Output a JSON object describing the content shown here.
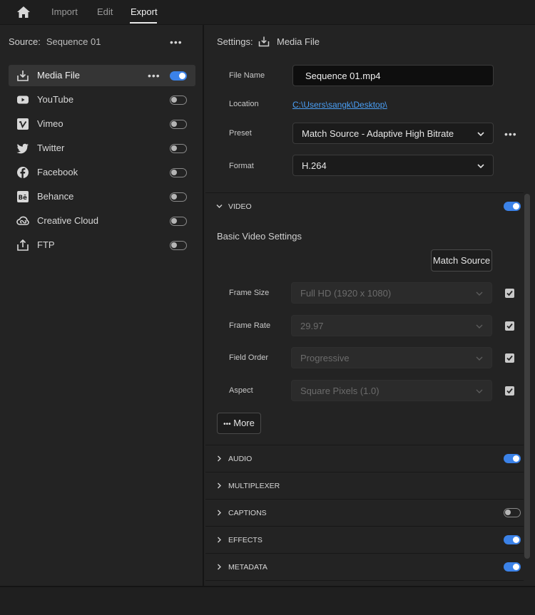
{
  "nav": {
    "tabs": [
      {
        "label": "Import"
      },
      {
        "label": "Edit"
      },
      {
        "label": "Export"
      }
    ]
  },
  "source": {
    "label": "Source:",
    "value": "Sequence 01"
  },
  "destinations": [
    {
      "label": "Media File",
      "icon": "download-icon",
      "enabled": true
    },
    {
      "label": "YouTube",
      "icon": "youtube-icon",
      "enabled": false
    },
    {
      "label": "Vimeo",
      "icon": "vimeo-icon",
      "enabled": false
    },
    {
      "label": "Twitter",
      "icon": "twitter-icon",
      "enabled": false
    },
    {
      "label": "Facebook",
      "icon": "facebook-icon",
      "enabled": false
    },
    {
      "label": "Behance",
      "icon": "behance-icon",
      "enabled": false
    },
    {
      "label": "Creative Cloud",
      "icon": "creative-cloud-icon",
      "enabled": false
    },
    {
      "label": "FTP",
      "icon": "upload-icon",
      "enabled": false
    }
  ],
  "settings": {
    "label": "Settings:",
    "value": "Media File",
    "file_name_label": "File Name",
    "file_name": "Sequence 01.mp4",
    "location_label": "Location",
    "location": "C:\\Users\\sangk\\Desktop\\",
    "preset_label": "Preset",
    "preset": "Match Source - Adaptive High Bitrate",
    "format_label": "Format",
    "format": "H.264"
  },
  "video": {
    "title": "VIDEO",
    "enabled": true,
    "basic_title": "Basic Video Settings",
    "match_source_label": "Match Source",
    "fields": [
      {
        "label": "Frame Size",
        "value": "Full HD (1920 x 1080)",
        "checked": true
      },
      {
        "label": "Frame Rate",
        "value": "29.97",
        "checked": true
      },
      {
        "label": "Field Order",
        "value": "Progressive",
        "checked": true
      },
      {
        "label": "Aspect",
        "value": "Square Pixels (1.0)",
        "checked": true
      }
    ],
    "more_label": "More"
  },
  "sections": [
    {
      "title": "AUDIO",
      "toggle": true,
      "enabled": true
    },
    {
      "title": "MULTIPLEXER",
      "toggle": false
    },
    {
      "title": "CAPTIONS",
      "toggle": true,
      "enabled": false
    },
    {
      "title": "EFFECTS",
      "toggle": true,
      "enabled": true
    },
    {
      "title": "METADATA",
      "toggle": true,
      "enabled": true
    }
  ],
  "colors": {
    "accent": "#3b82e8",
    "link": "#4a9ff5",
    "background": "#232323"
  }
}
